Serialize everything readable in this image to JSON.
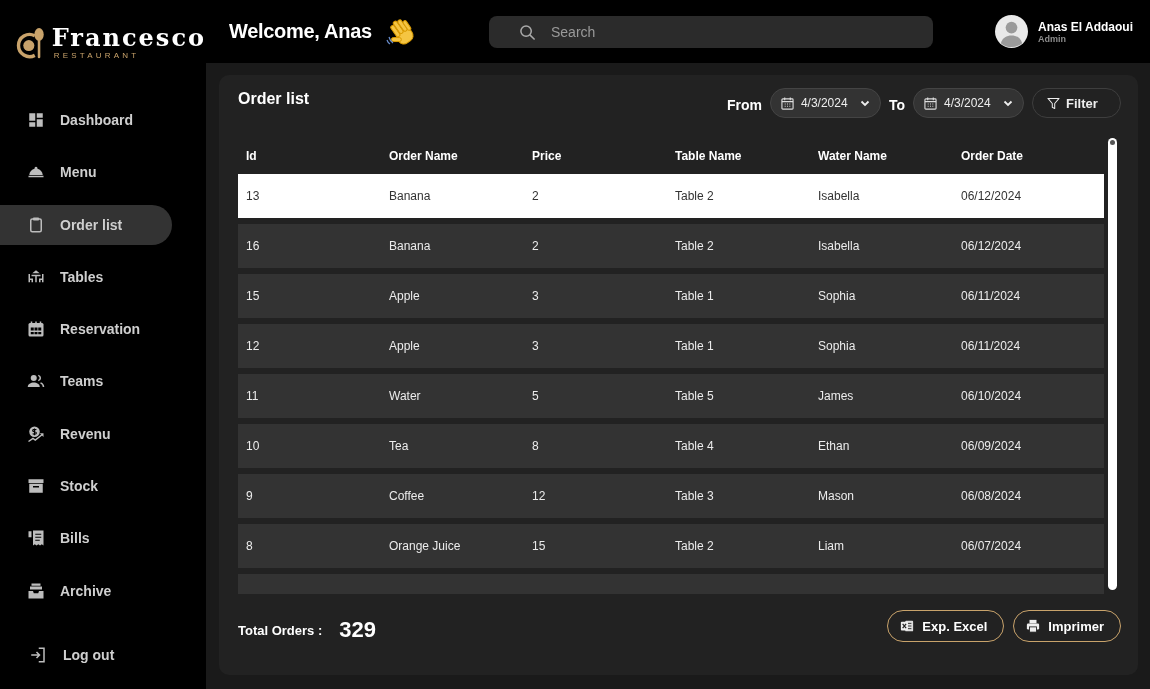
{
  "brand": {
    "name": "Francesco",
    "tagline": "RESTAURANT"
  },
  "header": {
    "greeting": "Welcome, Anas",
    "search": {
      "placeholder": "Search"
    },
    "user": {
      "name": "Anas El Addaoui",
      "role": "Admin"
    }
  },
  "sidebar": {
    "items": [
      {
        "label": "Dashboard",
        "selected": false
      },
      {
        "label": "Menu",
        "selected": false
      },
      {
        "label": "Order list",
        "selected": true
      },
      {
        "label": "Tables",
        "selected": false
      },
      {
        "label": "Reservation",
        "selected": false
      },
      {
        "label": "Teams",
        "selected": false
      },
      {
        "label": "Revenu",
        "selected": false
      },
      {
        "label": "Stock",
        "selected": false
      },
      {
        "label": "Bills",
        "selected": false
      },
      {
        "label": "Archive",
        "selected": false
      }
    ],
    "logout": {
      "label": "Log out"
    }
  },
  "order_list": {
    "title": "Order list",
    "filters": {
      "from_label": "From",
      "from_date": "4/3/2024",
      "to_label": "To",
      "to_date": "4/3/2024",
      "filter_button": "Filter"
    },
    "table": {
      "columns": [
        "Id",
        "Order Name",
        "Price",
        "Table Name",
        "Water Name",
        "Order Date"
      ],
      "rows": [
        {
          "cells": [
            "13",
            "Banana",
            "2",
            "Table 2",
            "Isabella",
            "06/12/2024"
          ],
          "selected": true
        },
        {
          "cells": [
            "16",
            "Banana",
            "2",
            "Table 2",
            "Isabella",
            "06/12/2024"
          ],
          "selected": false
        },
        {
          "cells": [
            "15",
            "Apple",
            "3",
            "Table 1",
            "Sophia",
            "06/11/2024"
          ],
          "selected": false
        },
        {
          "cells": [
            "12",
            "Apple",
            "3",
            "Table 1",
            "Sophia",
            "06/11/2024"
          ],
          "selected": false
        },
        {
          "cells": [
            "11",
            "Water",
            "5",
            "Table 5",
            "James",
            "06/10/2024"
          ],
          "selected": false
        },
        {
          "cells": [
            "10",
            "Tea",
            "8",
            "Table 4",
            "Ethan",
            "06/09/2024"
          ],
          "selected": false
        },
        {
          "cells": [
            "9",
            "Coffee",
            "12",
            "Table 3",
            "Mason",
            "06/08/2024"
          ],
          "selected": false
        },
        {
          "cells": [
            "8",
            "Orange Juice",
            "15",
            "Table 2",
            "Liam",
            "06/07/2024"
          ],
          "selected": false
        }
      ],
      "more_rows_below": true
    },
    "footer": {
      "total_label": "Total Orders :",
      "total_value": "329",
      "buttons": [
        "Exp. Excel",
        "Imprimer"
      ]
    }
  }
}
